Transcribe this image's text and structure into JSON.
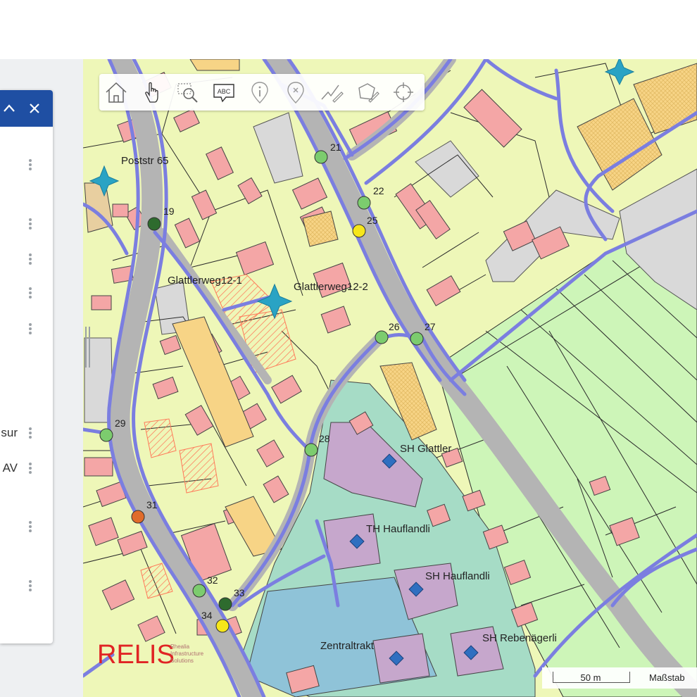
{
  "panel": {
    "collapse_icon": "chevron-up-icon",
    "close_icon": "close-icon",
    "rows": [
      {
        "label": ""
      },
      {
        "label": ""
      },
      {
        "label": ""
      },
      {
        "label": ""
      },
      {
        "label": ""
      },
      {
        "label": "sur"
      },
      {
        "label": "AV"
      },
      {
        "label": ""
      },
      {
        "label": ""
      }
    ]
  },
  "toolbar": {
    "tools": [
      {
        "icon": "home-icon"
      },
      {
        "icon": "hand-pointer-icon"
      },
      {
        "icon": "zoom-area-icon"
      },
      {
        "icon": "label-icon",
        "text": "ABC"
      },
      {
        "icon": "info-icon"
      },
      {
        "icon": "marker-icon"
      },
      {
        "icon": "measure-line-icon"
      },
      {
        "icon": "measure-area-icon"
      },
      {
        "icon": "locate-icon"
      }
    ]
  },
  "map": {
    "labels": {
      "poststr": "Poststr 65",
      "glattlerweg1": "Glattlerweg12-1",
      "glattlerweg2": "Glattlerweg12-2",
      "sh_glattler": "SH Glattler",
      "th_haufl": "TH Hauflandli",
      "sh_haufl": "SH Hauflandli",
      "sh_reben": "SH Rebenägerli",
      "zentral": "Zentraltrakt"
    },
    "points": [
      {
        "id": "19",
        "color": "#2e6b2e"
      },
      {
        "id": "21",
        "color": "#7ccc6e"
      },
      {
        "id": "22",
        "color": "#7ccc6e"
      },
      {
        "id": "25",
        "color": "#f6e61a"
      },
      {
        "id": "26",
        "color": "#7ccc6e"
      },
      {
        "id": "27",
        "color": "#7ccc6e"
      },
      {
        "id": "28",
        "color": "#7ccc6e"
      },
      {
        "id": "29",
        "color": "#7ccc6e"
      },
      {
        "id": "31",
        "color": "#e06b2a"
      },
      {
        "id": "32",
        "color": "#7ccc6e"
      },
      {
        "id": "33",
        "color": "#2e6b2e"
      },
      {
        "id": "34",
        "color": "#f6e61a"
      }
    ]
  },
  "logo": {
    "word": "RELIS",
    "tagline": "Rhealia Infrastructure Solutions"
  },
  "scale": {
    "bar_label": "50 m",
    "text": "Maßstab"
  },
  "colors": {
    "header_blue": "#1f4fa3",
    "road_blue": "#7b7ee0",
    "building": "#f4a6a6",
    "zone": "#eef7b8"
  }
}
